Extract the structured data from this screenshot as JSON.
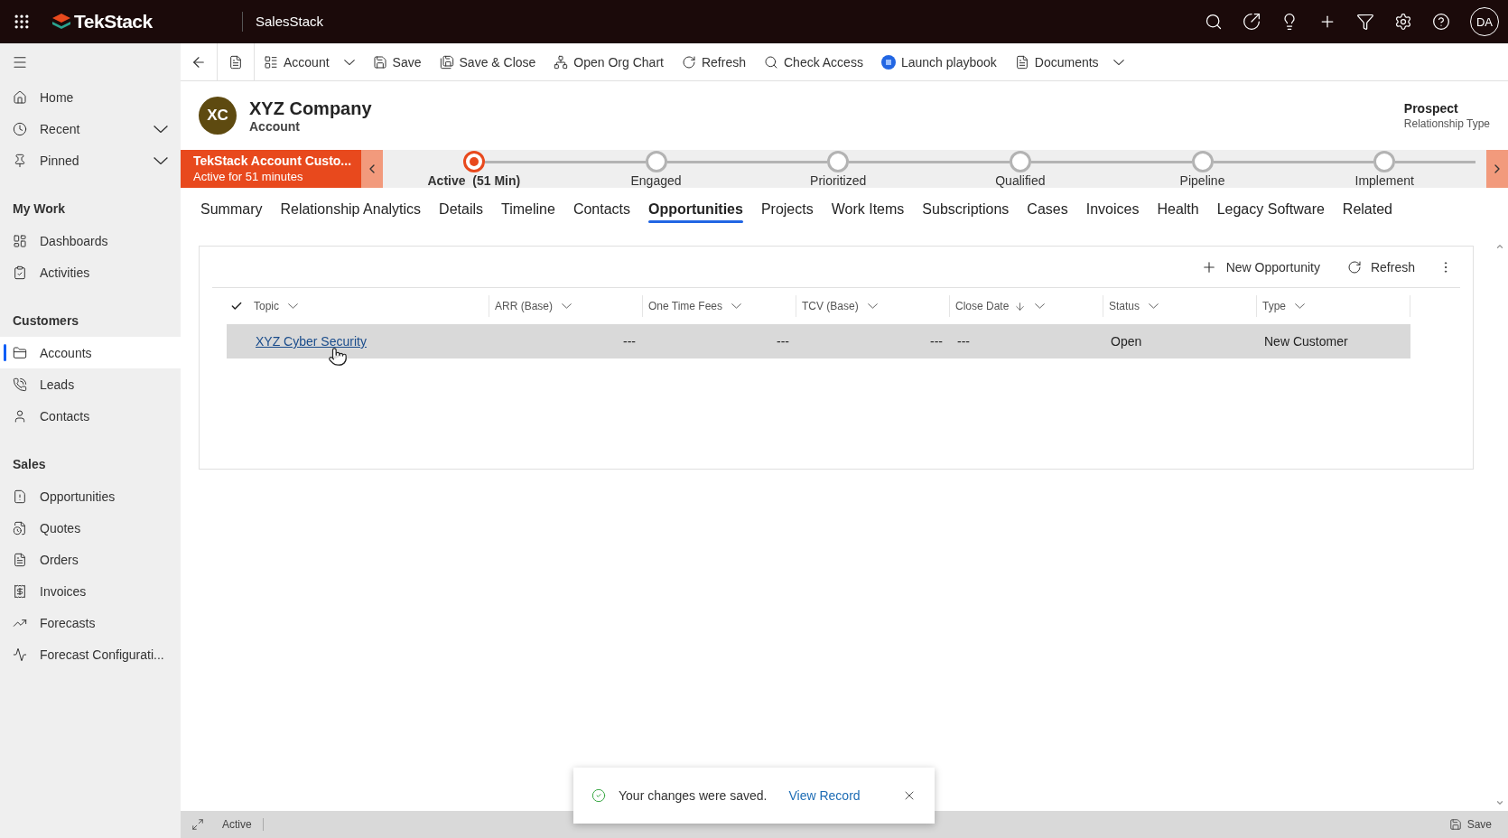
{
  "app_bar": {
    "app_name": "TekStack",
    "area": "SalesStack",
    "avatar": "DA"
  },
  "command_bar": [
    {
      "label": "Account",
      "has_menu": true
    },
    {
      "label": "Save",
      "has_menu": false
    },
    {
      "label": "Save & Close",
      "has_menu": false
    },
    {
      "label": "Open Org Chart",
      "has_menu": false
    },
    {
      "label": "Refresh",
      "has_menu": false
    },
    {
      "label": "Check Access",
      "has_menu": false
    },
    {
      "label": "Launch playbook",
      "has_menu": false
    },
    {
      "label": "Documents",
      "has_menu": true
    }
  ],
  "sidebar": {
    "nav": [
      {
        "label": "Home",
        "expandable": false
      },
      {
        "label": "Recent",
        "expandable": true
      },
      {
        "label": "Pinned",
        "expandable": true
      }
    ],
    "groups": [
      {
        "title": "My Work",
        "items": [
          {
            "label": "Dashboards",
            "selected": false
          },
          {
            "label": "Activities",
            "selected": false
          }
        ]
      },
      {
        "title": "Customers",
        "items": [
          {
            "label": "Accounts",
            "selected": true
          },
          {
            "label": "Leads",
            "selected": false
          },
          {
            "label": "Contacts",
            "selected": false
          }
        ]
      },
      {
        "title": "Sales",
        "items": [
          {
            "label": "Opportunities",
            "selected": false
          },
          {
            "label": "Quotes",
            "selected": false
          },
          {
            "label": "Orders",
            "selected": false
          },
          {
            "label": "Invoices",
            "selected": false
          },
          {
            "label": "Forecasts",
            "selected": false
          },
          {
            "label": "Forecast Configurati...",
            "selected": false
          }
        ]
      }
    ]
  },
  "record": {
    "initials": "XC",
    "name": "XYZ Company",
    "entity": "Account",
    "field_value": "Prospect",
    "field_label": "Relationship Type"
  },
  "process": {
    "name": "TekStack Account Custo...",
    "duration": "Active for 51 minutes",
    "stages": [
      {
        "label": "Active  (51 Min)",
        "selected": true
      },
      {
        "label": "Engaged",
        "selected": false
      },
      {
        "label": "Prioritized",
        "selected": false
      },
      {
        "label": "Qualified",
        "selected": false
      },
      {
        "label": "Pipeline",
        "selected": false
      },
      {
        "label": "Implement",
        "selected": false
      }
    ]
  },
  "tabs": [
    {
      "label": "Summary",
      "selected": false
    },
    {
      "label": "Relationship Analytics",
      "selected": false
    },
    {
      "label": "Details",
      "selected": false
    },
    {
      "label": "Timeline",
      "selected": false
    },
    {
      "label": "Contacts",
      "selected": false
    },
    {
      "label": "Opportunities",
      "selected": true
    },
    {
      "label": "Projects",
      "selected": false
    },
    {
      "label": "Work Items",
      "selected": false
    },
    {
      "label": "Subscriptions",
      "selected": false
    },
    {
      "label": "Cases",
      "selected": false
    },
    {
      "label": "Invoices",
      "selected": false
    },
    {
      "label": "Health",
      "selected": false
    },
    {
      "label": "Legacy Software",
      "selected": false
    },
    {
      "label": "Related",
      "selected": false
    }
  ],
  "grid": {
    "actions": [
      "New Opportunity",
      "Refresh"
    ],
    "select_all_checked": true,
    "columns": [
      {
        "label": "Topic",
        "sorted": false,
        "kind": "text"
      },
      {
        "label": "ARR (Base)",
        "sorted": false,
        "kind": "number"
      },
      {
        "label": "One Time Fees",
        "sorted": false,
        "kind": "number"
      },
      {
        "label": "TCV (Base)",
        "sorted": false,
        "kind": "number"
      },
      {
        "label": "Close Date",
        "sorted": true,
        "kind": "text"
      },
      {
        "label": "Status",
        "sorted": false,
        "kind": "text"
      },
      {
        "label": "Type",
        "sorted": false,
        "kind": "text"
      }
    ],
    "rows": [
      {
        "selected": true,
        "cells": [
          "XYZ Cyber Security",
          "---",
          "---",
          "---",
          "---",
          "Open",
          "New Customer"
        ]
      }
    ]
  },
  "toast": {
    "message": "Your changes were saved.",
    "link": "View Record"
  },
  "status_bar": {
    "status": "Active",
    "save": "Save"
  }
}
